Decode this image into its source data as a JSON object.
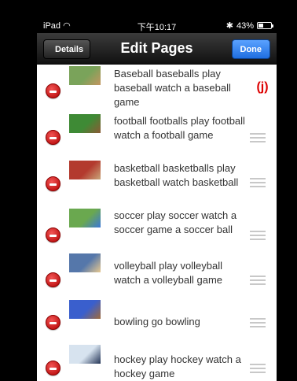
{
  "status_bar": {
    "device": "iPad",
    "time": "下午10:17",
    "battery": "43%",
    "battery_level": 0.43
  },
  "navbar": {
    "title": "Edit Pages",
    "back_label": "Details",
    "done_label": "Done"
  },
  "rows": [
    {
      "text": "Baseball  baseballs  play baseball  watch a baseball game",
      "badge": "(j)",
      "colors": [
        "#7aa35a",
        "#c39560"
      ]
    },
    {
      "text": "football  footballs  play football  watch a football game",
      "colors": [
        "#3e8a35",
        "#8c5a35"
      ]
    },
    {
      "text": "basketball  basketballs  play basketball  watch basketball",
      "colors": [
        "#b33a2e",
        "#c9a67a"
      ]
    },
    {
      "text": "soccer  play soccer  watch a soccer game  a soccer ball",
      "colors": [
        "#6aa84f",
        "#3c78d8"
      ]
    },
    {
      "text": "volleyball  play volleyball  watch a volleyball game",
      "colors": [
        "#5577aa",
        "#e8c990"
      ]
    },
    {
      "text": "bowling  go bowling",
      "colors": [
        "#3a5fcd",
        "#a06a3a"
      ]
    },
    {
      "text": "hockey  play hockey  watch a hockey game",
      "colors": [
        "#d7e3ef",
        "#223355"
      ]
    }
  ]
}
